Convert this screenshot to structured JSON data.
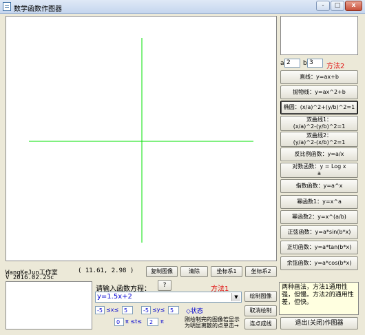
{
  "window": {
    "title": "数学函数作图器",
    "buttons": {
      "minimize": "-",
      "maximize": "□",
      "close": "x"
    }
  },
  "colors": {
    "axis": "#00e000",
    "accent_red": "#e01010",
    "accent_blue": "#0000d0"
  },
  "params": {
    "a_label": "a",
    "a_value": "2",
    "b_label": "b",
    "b_value": "3",
    "method_label": "方法2"
  },
  "function_buttons": [
    {
      "label": "直线：y=ax+b"
    },
    {
      "label": "抛物线：y=ax^2+b"
    },
    {
      "label": "椭圆：(x/a)^2+(y/b)^2=1"
    },
    {
      "label": "双曲线1：\n(x/a)^2-(y/b)^2=1"
    },
    {
      "label": "双曲线2：\n(y/a)^2-(x/b)^2=1"
    },
    {
      "label": "反比例函数：y=a/x"
    },
    {
      "label": "对数函数：y = Log  x\n        a"
    },
    {
      "label": "指数函数：y=a^x"
    },
    {
      "label": "幂函数1：y=x^a"
    },
    {
      "label": "幂函数2：y=x^(a/b)"
    },
    {
      "label": "正弦函数：y=a*sin(b*x)"
    },
    {
      "label": "正切函数：y=a*tan(b*x)"
    },
    {
      "label": "余弦函数：y=a*cos(b*x)"
    }
  ],
  "studio": {
    "name": "WangKeJun工作室",
    "version": "V 2016.02.25c"
  },
  "coordinate_readout": "( 11.61, 2.98 )",
  "toolbar": {
    "copy": "复制图像",
    "clear": "清除",
    "coord1": "坐标系1",
    "coord2": "坐标系2"
  },
  "equation": {
    "prompt": "请输入函数方程：",
    "help": "?",
    "method_label": "方法1",
    "value": "y=1.5x+2",
    "draw": "绘制图像",
    "cancel": "取消绘制",
    "connect": "连点成线"
  },
  "ranges": {
    "x_min": "-5",
    "x_sym": "≤x≤",
    "x_max": "5",
    "y_min": "-5",
    "y_sym": "≤y≤",
    "y_max": "5",
    "status": "◇状态",
    "t_min": "0",
    "t_sym": "π ≤t≤",
    "t_max": "2",
    "t_unit": "π"
  },
  "note": {
    "line1": "刚绘制完的图像若显示",
    "line2": "为明显离散的点单击→"
  },
  "method_info": "两种画法，方法1通用性强，但慢。方法2的通用性差，但快。",
  "exit": "退出(关闭)作图器"
}
